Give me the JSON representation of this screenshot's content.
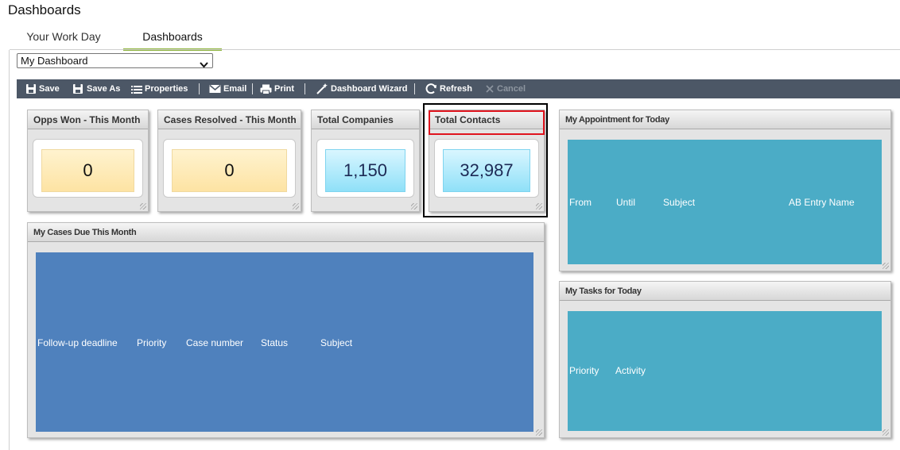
{
  "page": {
    "title": "Dashboards"
  },
  "tabs": [
    {
      "label": "Your Work Day"
    },
    {
      "label": "Dashboards"
    }
  ],
  "dashboard_select": {
    "value": "My Dashboard"
  },
  "toolbar": {
    "save": "Save",
    "save_as": "Save As",
    "properties": "Properties",
    "email": "Email",
    "print": "Print",
    "wizard": "Dashboard Wizard",
    "refresh": "Refresh",
    "cancel": "Cancel"
  },
  "kpis": [
    {
      "title": "Opps Won - This Month",
      "value": "0"
    },
    {
      "title": "Cases Resolved - This Month",
      "value": "0"
    },
    {
      "title": "Total Companies",
      "value": "1,150"
    },
    {
      "title": "Total Contacts",
      "value": "32,987"
    }
  ],
  "cases_gadget": {
    "title": "My Cases Due This Month",
    "columns": [
      "Follow-up deadline",
      "Priority",
      "Case number",
      "Status",
      "Subject"
    ],
    "color": "#4f81bd"
  },
  "appointments_gadget": {
    "title": "My Appointment for Today",
    "columns": [
      "From",
      "Until",
      "Subject",
      "AB Entry Name"
    ],
    "color": "#4bacc6"
  },
  "tasks_gadget": {
    "title": "My Tasks for Today",
    "columns": [
      "Priority",
      "Activity"
    ],
    "color": "#4bacc6"
  }
}
